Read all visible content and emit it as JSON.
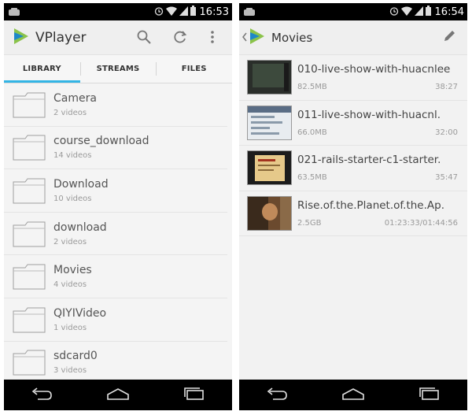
{
  "left_screen": {
    "status": {
      "time": "16:53"
    },
    "app_title": "VPlayer",
    "icons": {
      "search": "search-icon",
      "refresh": "refresh-icon",
      "overflow": "overflow-menu-icon"
    },
    "tabs": [
      {
        "label": "LIBRARY",
        "active": true
      },
      {
        "label": "STREAMS",
        "active": false
      },
      {
        "label": "FILES",
        "active": false
      }
    ],
    "folders": [
      {
        "name": "Camera",
        "count": "2 videos"
      },
      {
        "name": "course_download",
        "count": "14 videos"
      },
      {
        "name": "Download",
        "count": "10 videos"
      },
      {
        "name": "download",
        "count": "2 videos"
      },
      {
        "name": "Movies",
        "count": "4 videos"
      },
      {
        "name": "QIYIVideo",
        "count": "1 videos"
      },
      {
        "name": "sdcard0",
        "count": "3 videos"
      }
    ]
  },
  "right_screen": {
    "status": {
      "time": "16:54"
    },
    "title": "Movies",
    "icons": {
      "back": "back-chevron-icon",
      "edit": "pencil-icon"
    },
    "videos": [
      {
        "title": "010-live-show-with-huacnlee",
        "size": "82.5MB",
        "duration": "38:27"
      },
      {
        "title": "011-live-show-with-huacnl.",
        "size": "66.0MB",
        "duration": "32:00"
      },
      {
        "title": "021-rails-starter-c1-starter.",
        "size": "63.5MB",
        "duration": "35:47"
      },
      {
        "title": "Rise.of.the.Planet.of.the.Ap.",
        "size": "2.5GB",
        "duration": "01:23:33/01:44:56"
      }
    ]
  },
  "colors": {
    "accent": "#33b5e5",
    "logo_green": "#8bc34a",
    "logo_blue": "#1e88c8"
  }
}
